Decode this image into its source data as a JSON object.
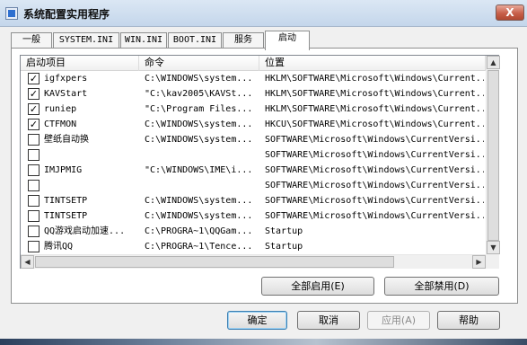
{
  "window": {
    "title": "系统配置实用程序",
    "close_label": "X"
  },
  "tabs": [
    {
      "label": "一般"
    },
    {
      "label": "SYSTEM.INI"
    },
    {
      "label": "WIN.INI"
    },
    {
      "label": "BOOT.INI"
    },
    {
      "label": "服务"
    },
    {
      "label": "启动"
    }
  ],
  "list": {
    "columns": [
      "启动项目",
      "命令",
      "位置"
    ],
    "rows": [
      {
        "checked": true,
        "item": "igfxpers",
        "command": "C:\\WINDOWS\\system...",
        "location": "HKLM\\SOFTWARE\\Microsoft\\Windows\\Current..."
      },
      {
        "checked": true,
        "item": "KAVStart",
        "command": "\"C:\\kav2005\\KAVSt...",
        "location": "HKLM\\SOFTWARE\\Microsoft\\Windows\\Current..."
      },
      {
        "checked": true,
        "item": "runiep",
        "command": "\"C:\\Program Files...",
        "location": "HKLM\\SOFTWARE\\Microsoft\\Windows\\Current..."
      },
      {
        "checked": true,
        "item": "CTFMON",
        "command": "C:\\WINDOWS\\system...",
        "location": "HKCU\\SOFTWARE\\Microsoft\\Windows\\Current..."
      },
      {
        "checked": false,
        "item": "壁纸自动换",
        "command": "C:\\WINDOWS\\system...",
        "location": "SOFTWARE\\Microsoft\\Windows\\CurrentVersi..."
      },
      {
        "checked": false,
        "item": "",
        "command": "",
        "location": "SOFTWARE\\Microsoft\\Windows\\CurrentVersi..."
      },
      {
        "checked": false,
        "item": "IMJPMIG",
        "command": "\"C:\\WINDOWS\\IME\\i...",
        "location": "SOFTWARE\\Microsoft\\Windows\\CurrentVersi..."
      },
      {
        "checked": false,
        "item": "",
        "command": "",
        "location": "SOFTWARE\\Microsoft\\Windows\\CurrentVersi..."
      },
      {
        "checked": false,
        "item": "TINTSETP",
        "command": "C:\\WINDOWS\\system...",
        "location": "SOFTWARE\\Microsoft\\Windows\\CurrentVersi..."
      },
      {
        "checked": false,
        "item": "TINTSETP",
        "command": "C:\\WINDOWS\\system...",
        "location": "SOFTWARE\\Microsoft\\Windows\\CurrentVersi..."
      },
      {
        "checked": false,
        "item": "QQ游戏启动加速...",
        "command": "C:\\PROGRA~1\\QQGam...",
        "location": "Startup"
      },
      {
        "checked": false,
        "item": "腾讯QQ",
        "command": "C:\\PROGRA~1\\Tence...",
        "location": "Startup"
      }
    ]
  },
  "buttons": {
    "enable_all": "全部启用(E)",
    "disable_all": "全部禁用(D)",
    "ok": "确定",
    "cancel": "取消",
    "apply": "应用(A)",
    "help": "帮助"
  },
  "glyphs": {
    "check": "✓",
    "scroll_up": "▲",
    "scroll_down": "▼",
    "scroll_left": "◀",
    "scroll_right": "▶"
  }
}
